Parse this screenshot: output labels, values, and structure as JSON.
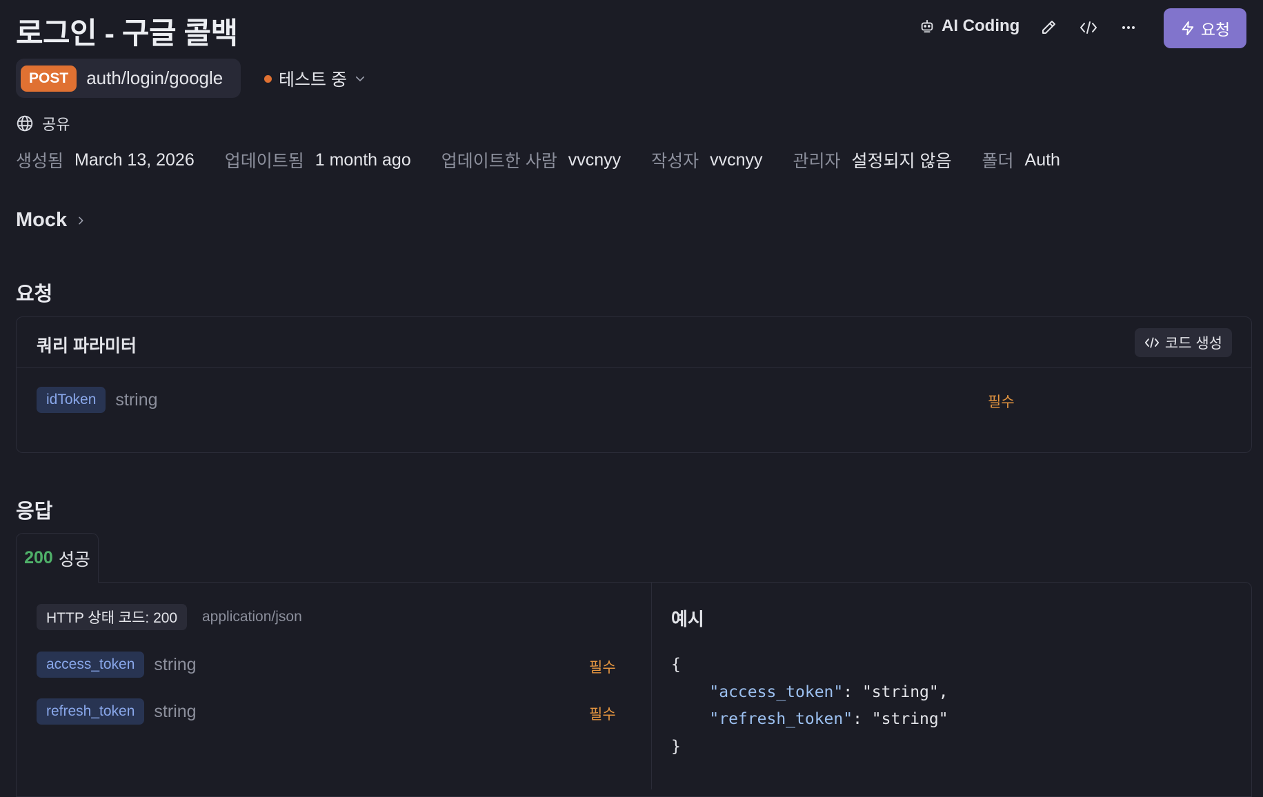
{
  "page": {
    "title": "로그인 - 구글 콜백"
  },
  "toolbar": {
    "ai_coding_label": "AI Coding",
    "send_label": "요청",
    "send_color": "#8174cc"
  },
  "endpoint": {
    "method": "POST",
    "method_color": "#e07132",
    "path": "auth/login/google"
  },
  "status": {
    "label": "테스트 중",
    "color": "#e07132"
  },
  "share": {
    "label": "공유"
  },
  "meta": [
    {
      "key": "생성됨",
      "value": "March 13, 2026"
    },
    {
      "key": "업데이트됨",
      "value": "1 month ago"
    },
    {
      "key": "업데이트한 사람",
      "value": "vvcnyy"
    },
    {
      "key": "작성자",
      "value": "vvcnyy"
    },
    {
      "key": "관리자",
      "value": "설정되지 않음"
    },
    {
      "key": "폴더",
      "value": "Auth"
    }
  ],
  "mock": {
    "label": "Mock"
  },
  "request": {
    "heading": "요청",
    "card_title": "쿼리 파라미터",
    "code_gen_label": "코드 생성",
    "params": [
      {
        "name": "idToken",
        "type": "string",
        "required": "필수"
      }
    ]
  },
  "response": {
    "heading": "응답",
    "tab_code": "200",
    "tab_label": "성공",
    "http_status": "HTTP 상태 코드: 200",
    "content_type": "application/json",
    "fields": [
      {
        "name": "access_token",
        "type": "string",
        "required": "필수"
      },
      {
        "name": "refresh_token",
        "type": "string",
        "required": "필수"
      }
    ],
    "example_title": "예시",
    "example": {
      "open": "{",
      "line1_key": "\"access_token\"",
      "line1_rest": ": \"string\",",
      "line2_key": "\"refresh_token\"",
      "line2_rest": ": \"string\"",
      "close": "}"
    }
  },
  "icons": [
    "robot-icon",
    "pencil-icon",
    "code-icon",
    "more-icon",
    "lightning-icon",
    "globe-icon",
    "chevron-down-icon",
    "chevron-right-icon"
  ]
}
